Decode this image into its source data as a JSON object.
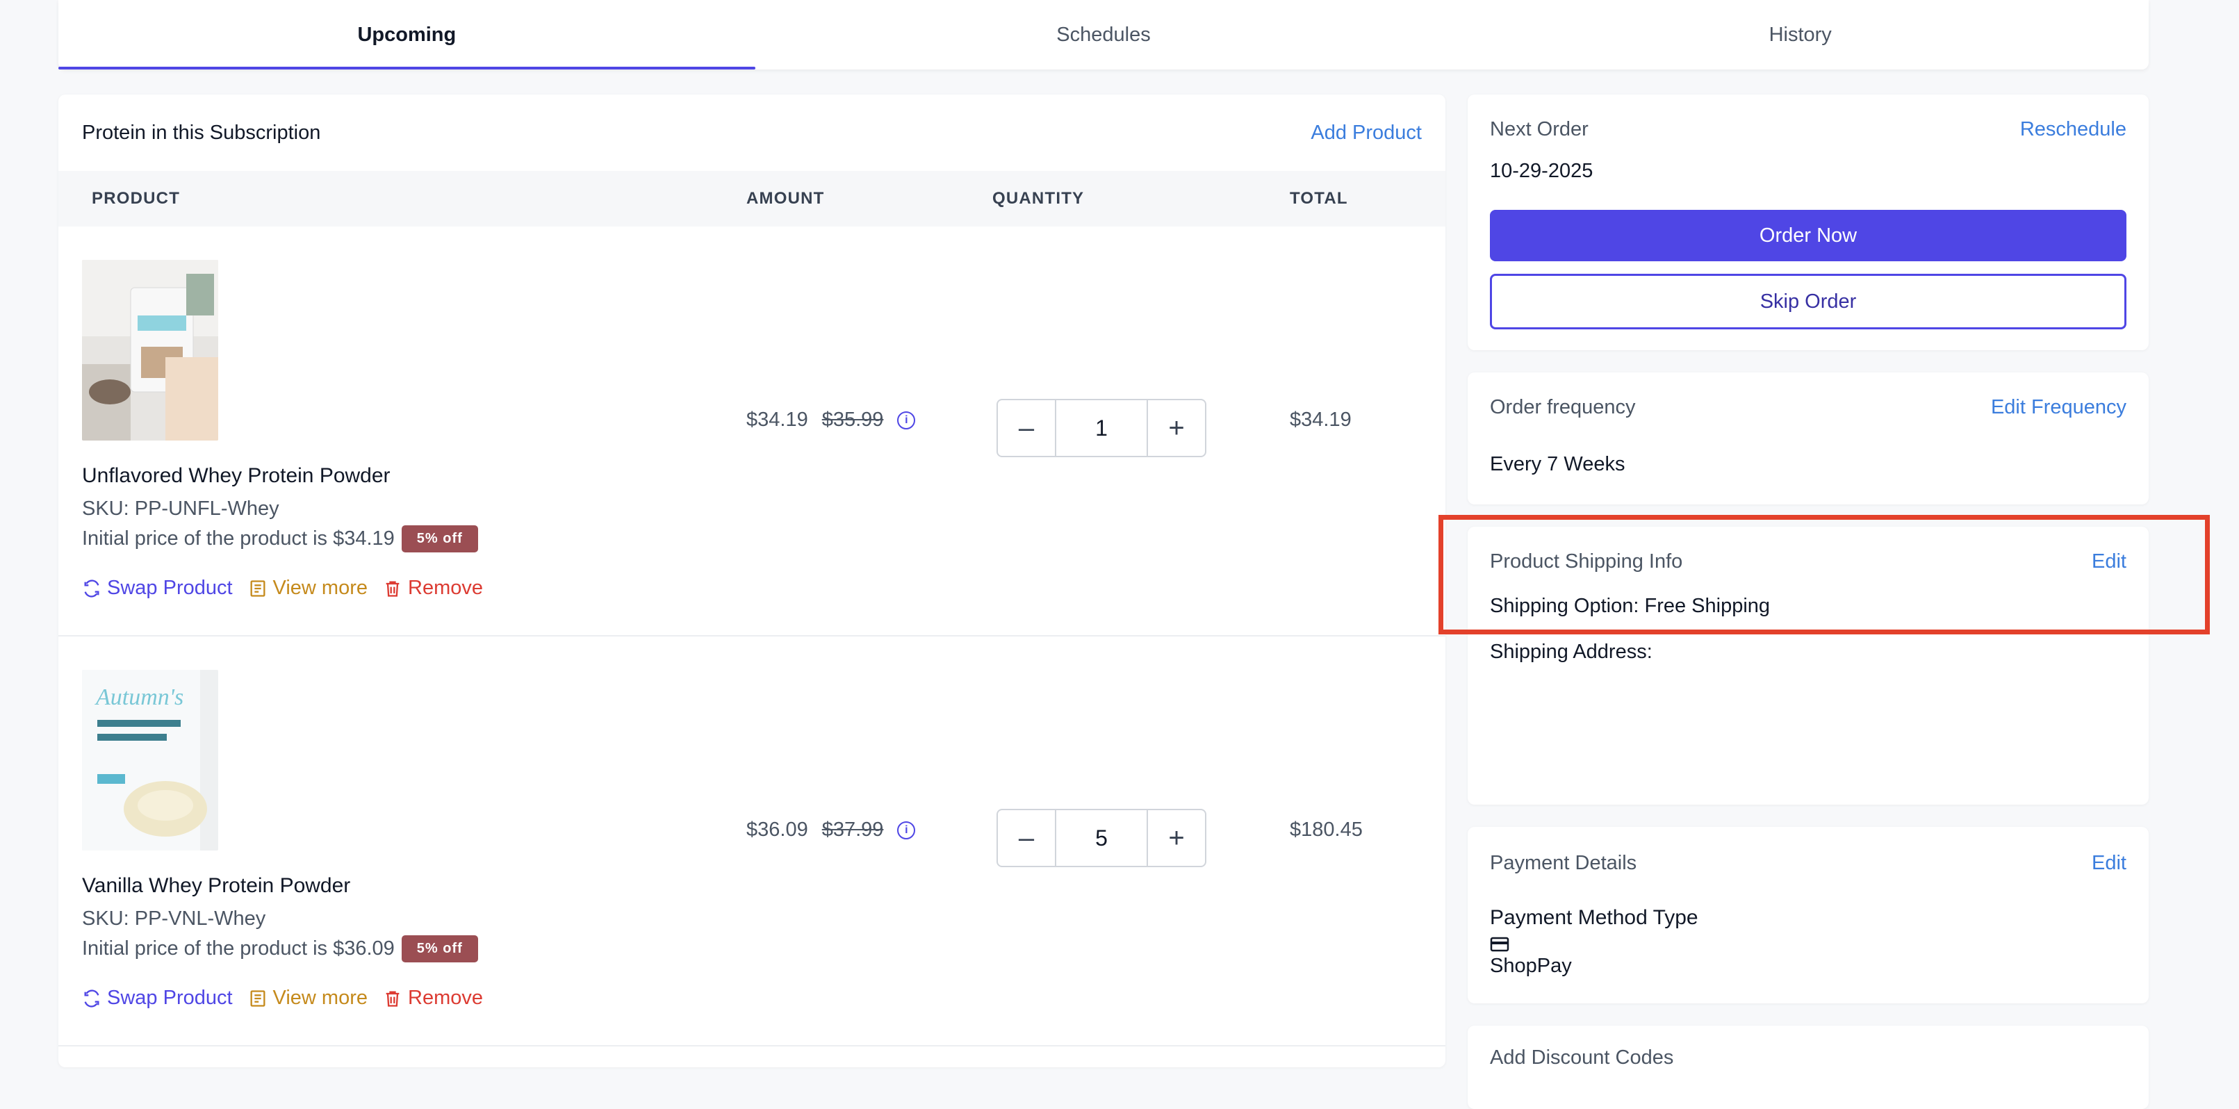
{
  "tabs": [
    {
      "label": "Upcoming",
      "active": true
    },
    {
      "label": "Schedules",
      "active": false
    },
    {
      "label": "History",
      "active": false
    }
  ],
  "main": {
    "title": "Protein in this Subscription",
    "add_product": "Add Product",
    "columns": [
      "PRODUCT",
      "AMOUNT",
      "QUANTITY",
      "TOTAL"
    ],
    "products": [
      {
        "name": "Unflavored Whey Protein Powder",
        "sku": "SKU: PP-UNFL-Whey",
        "initial_price": "Initial price of the product is $34.19",
        "badge": "5% off",
        "price": "$34.19",
        "old_price": "$35.99",
        "quantity": "1",
        "total": "$34.19",
        "actions": {
          "swap": "Swap Product",
          "view": "View more",
          "remove": "Remove"
        }
      },
      {
        "name": "Vanilla Whey Protein Powder",
        "sku": "SKU: PP-VNL-Whey",
        "initial_price": "Initial price of the product is $36.09",
        "badge": "5% off",
        "price": "$36.09",
        "old_price": "$37.99",
        "quantity": "5",
        "total": "$180.45",
        "actions": {
          "swap": "Swap Product",
          "view": "View more",
          "remove": "Remove"
        }
      }
    ]
  },
  "next_order": {
    "label": "Next Order",
    "reschedule": "Reschedule",
    "date": "10-29-2025",
    "order_now": "Order Now",
    "skip_order": "Skip Order"
  },
  "frequency": {
    "label": "Order frequency",
    "edit": "Edit Frequency",
    "value": "Every 7 Weeks"
  },
  "shipping": {
    "label": "Product Shipping Info",
    "edit": "Edit",
    "option": "Shipping Option: Free Shipping",
    "address": "Shipping Address:"
  },
  "payment": {
    "label": "Payment Details",
    "edit": "Edit",
    "method_type": "Payment Method Type",
    "method": "ShopPay"
  },
  "discount": {
    "label": "Add Discount Codes"
  },
  "colors": {
    "accent": "#4f46e5",
    "link": "#3b7ddd",
    "badge": "#9b4e53",
    "view": "#c58a1c",
    "remove": "#dc3b32",
    "highlight": "#e3412b"
  }
}
